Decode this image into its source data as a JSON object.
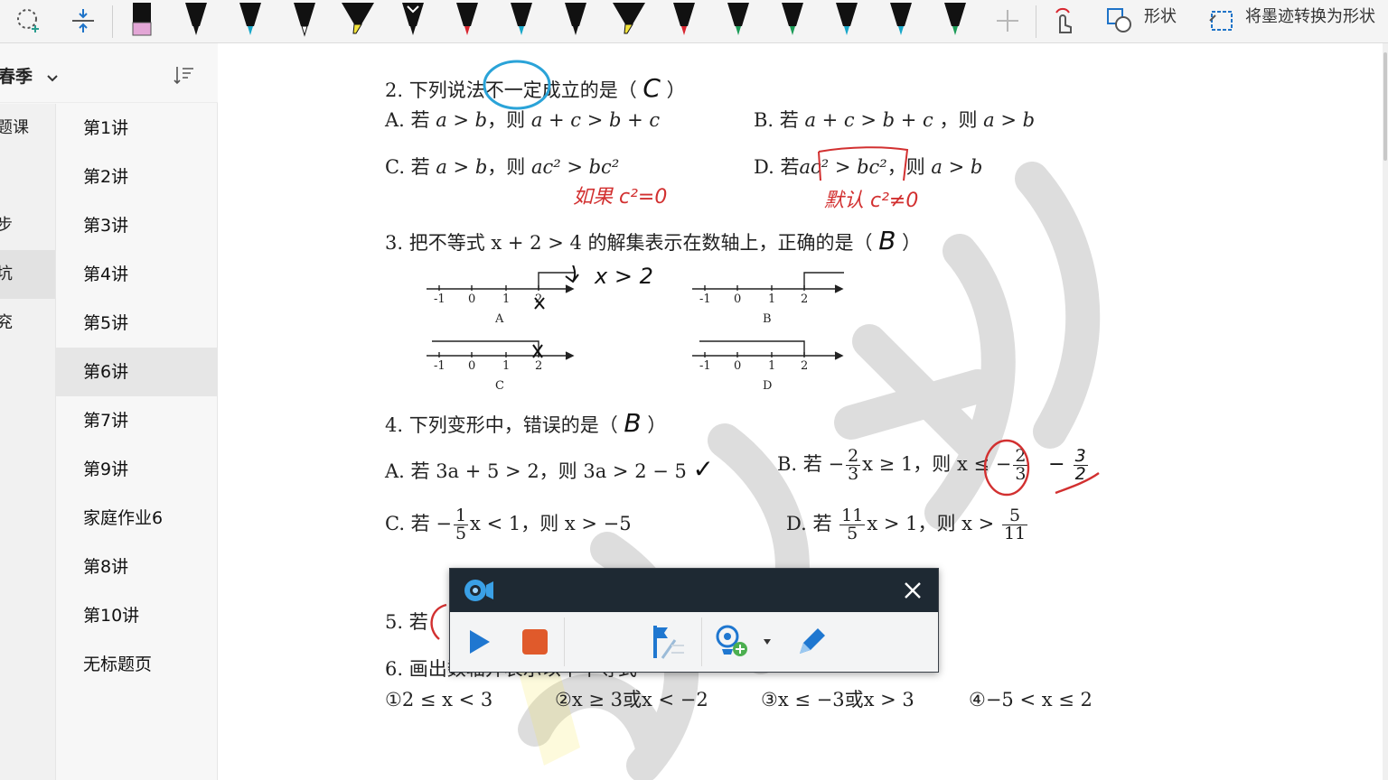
{
  "toolbar": {
    "shapes_label": "形状",
    "ink_to_shape_label": "将墨迹转换为形状",
    "colors": {
      "pink_highlighter": "#e3a6d6",
      "cyan": "#18a7c9",
      "yellow": "#f2e33c",
      "red": "#d8262f",
      "green": "#1b9b57",
      "black": "#111111",
      "accent_blue": "#1e73c8"
    }
  },
  "sidebar": {
    "section_title": "春季",
    "sections": [
      "题课",
      "",
      "步",
      "坑",
      "兖"
    ],
    "pages": [
      "第1讲",
      "第2讲",
      "第3讲",
      "第4讲",
      "第5讲",
      "第6讲",
      "第7讲",
      "第9讲",
      "家庭作业6",
      "第8讲",
      "第10讲",
      "无标题页"
    ],
    "selected_page": "第6讲"
  },
  "doc": {
    "q2": {
      "stem": "2. 下列说法不一定成立的是（",
      "answer": "C",
      "close": "）",
      "a_pre": "A. 若 ",
      "a_math": "a > b",
      "a_mid": "，则 ",
      "a_math2": "a + c > b + c",
      "b_pre": "B. 若 ",
      "b_math": "a + c > b + c",
      "b_mid": " ，则 ",
      "b_math2": "a > b",
      "c_pre": "C. 若 ",
      "c_math": "a > b",
      "c_mid": "，则 ",
      "c_math2": "ac² > bc²",
      "d_pre": "D. 若",
      "d_math": "ac² > bc²",
      "d_mid": "，则 ",
      "d_math2": "a > b",
      "note_c": "如果 c²=0",
      "note_d": "默认 c²≠0"
    },
    "q3": {
      "stem": "3. 把不等式 x + 2 > 4 的解集表示在数轴上，正确的是（",
      "answer": "B",
      "close": "）",
      "note": "x > 2",
      "ticks": [
        "-1",
        "0",
        "1",
        "2"
      ],
      "labels": [
        "A",
        "B",
        "C",
        "D"
      ]
    },
    "q4": {
      "stem": "4. 下列变形中，错误的是（",
      "answer": "B",
      "close": "）",
      "a_text": "A. 若 3a + 5 > 2，则 3a > 2 − 5",
      "a_check": "✓",
      "b_pre": "B. 若 −",
      "b_num": "2",
      "b_den": "3",
      "b_mid": "x ≥ 1，则 x ≤ −",
      "b_num2": "2",
      "b_den2": "3",
      "b_note": "− ",
      "b_note_num": "3",
      "b_note_den": "2",
      "c_pre": "C. 若 −",
      "c_num": "1",
      "c_den": "5",
      "c_mid": "x < 1，则 x > −5",
      "d_pre": "D. 若 ",
      "d_num": "11",
      "d_den": "5",
      "d_mid": "x > 1，则 x > ",
      "d_num2": "5",
      "d_den2": "11"
    },
    "q5": {
      "stem": "5. 若"
    },
    "q6": {
      "stem": "6. 画出数轴并表示以下不等式",
      "items": [
        "①2 ≤ x < 3",
        "②x ≥ 3或x < −2",
        "③x ≤ −3或x > 3",
        "④−5 < x ≤ 2"
      ]
    }
  },
  "recorder": {
    "colors": {
      "titlebar": "#1e2933",
      "play": "#1f77d0",
      "stop": "#e05a2b"
    }
  }
}
